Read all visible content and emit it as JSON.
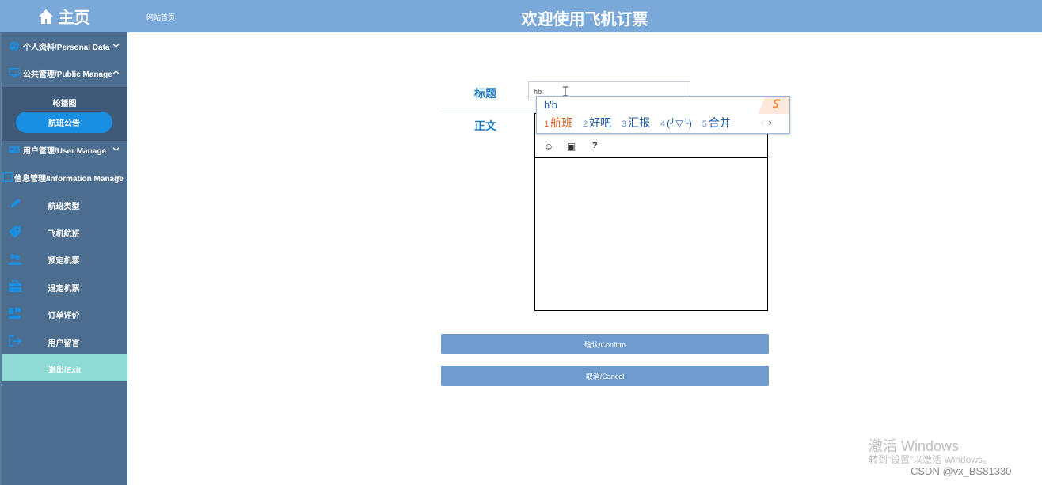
{
  "brand": {
    "label": "主页",
    "icon": "home-icon"
  },
  "header": {
    "breadcrumb": "网站首页",
    "title": "欢迎使用飞机订票"
  },
  "sidebar": {
    "groups": [
      {
        "label": "个人资料/Personal Data",
        "icon": "globe-icon"
      },
      {
        "label": "公共管理/Public Manage",
        "icon": "monitor-icon",
        "expanded": true
      },
      {
        "label": "用户管理/User Manage",
        "icon": "id-card-icon"
      },
      {
        "label": "信息管理/Information Manage",
        "icon": "info-icon",
        "expanded": true
      }
    ],
    "public_sub": [
      {
        "label": "轮播图"
      },
      {
        "label": "航班公告",
        "active": true
      }
    ],
    "info_items": [
      {
        "label": "航班类型",
        "icon": "pencil-icon"
      },
      {
        "label": "飞机航班",
        "icon": "tag-icon"
      },
      {
        "label": "预定机票",
        "icon": "users-icon"
      },
      {
        "label": "退定机票",
        "icon": "briefcase-icon"
      },
      {
        "label": "订单评价",
        "icon": "chart-icon"
      },
      {
        "label": "用户留言",
        "icon": "logout-icon"
      }
    ],
    "exit": "退出/Exit"
  },
  "form": {
    "title_label": "标题",
    "title_value": "hb",
    "body_label": "正文",
    "editor_tools": [
      "☺",
      "▣",
      "?"
    ],
    "confirm": "确认/Confirm",
    "cancel": "取消/Cancel"
  },
  "ime": {
    "composition": "h'b",
    "candidates": [
      {
        "num": "1",
        "text": "航班"
      },
      {
        "num": "2",
        "text": "好吧"
      },
      {
        "num": "3",
        "text": "汇报"
      },
      {
        "num": "4",
        "text": "(╯▽╰)"
      },
      {
        "num": "5",
        "text": "合并"
      }
    ],
    "prev": "‹",
    "next": "›"
  },
  "watermark": {
    "line1": "激活 Windows",
    "line2": "转到“设置”以激活 Windows。"
  },
  "credit": "CSDN @vx_BS81330",
  "colors": {
    "header": "#7aa8d9",
    "sidebar": "#4d6d8f",
    "active": "#1a8ee0",
    "exit": "#8fdad4",
    "button": "#6f9bcf"
  }
}
